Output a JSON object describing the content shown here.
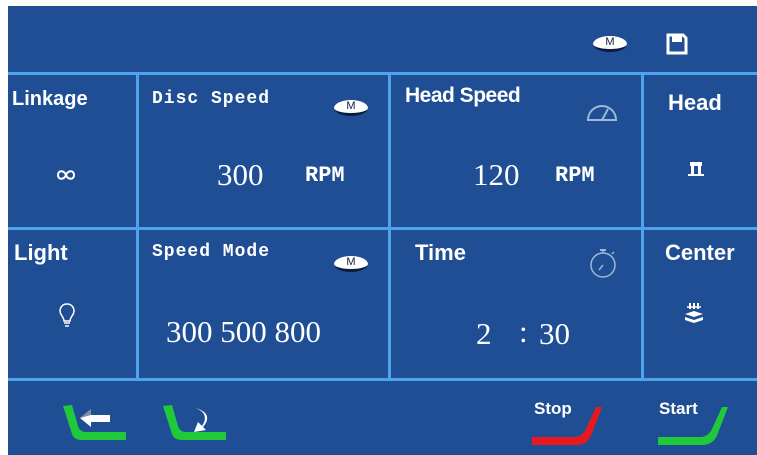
{
  "topbar": {
    "mode_badge": "M",
    "icons": [
      "mode-badge-icon",
      "save-icon"
    ]
  },
  "grid": {
    "linkage": {
      "label": "Linkage",
      "icon": "linkage-icon"
    },
    "disc_speed": {
      "label": "Disc Speed",
      "badge": "M",
      "value": "300",
      "unit": "RPM"
    },
    "head_speed": {
      "label": "Head Speed",
      "icon": "gauge-icon",
      "value": "120",
      "unit": "RPM"
    },
    "head": {
      "label": "Head",
      "icon": "head-icon"
    },
    "light": {
      "label": "Light",
      "icon": "bulb-icon"
    },
    "speed_mode": {
      "label": "Speed Mode",
      "badge": "M",
      "values": "300 500 800"
    },
    "time": {
      "label": "Time",
      "icon": "stopwatch-icon",
      "minutes": "2",
      "separator": ":",
      "seconds": "30"
    },
    "center": {
      "label": "Center",
      "icon": "center-icon"
    }
  },
  "bottombar": {
    "back_icon": "back-arrow-icon",
    "forward_icon": "forward-arrow-icon",
    "stop_label": "Stop",
    "start_label": "Start"
  },
  "colors": {
    "background": "#1f4e94",
    "grid_lines": "#4fa3ec",
    "stop": "#e8191e",
    "start": "#1fc93a",
    "nav_arrows": "#1fc93a"
  }
}
